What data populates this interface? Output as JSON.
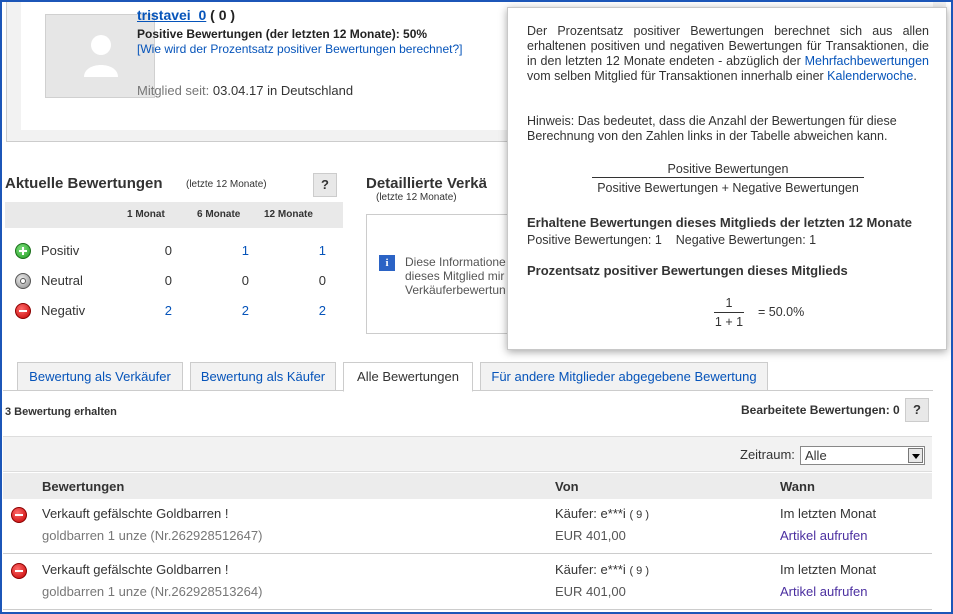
{
  "profile": {
    "username": "tristavei_0",
    "score": "( 0 )",
    "positive_percentage": "Positive Bewertungen (der letzten 12 Monate): 50%",
    "percentage_link": "[Wie wird der Prozentsatz positiver Bewertungen berechnet?]",
    "member_since_label": "Mitglied seit:",
    "member_since_value": "03.04.17 in Deutschland"
  },
  "current_ratings": {
    "title": "Aktuelle Bewertungen",
    "subtitle": "(letzte 12 Monate)",
    "help": "?",
    "columns": [
      "1 Monat",
      "6 Monate",
      "12 Monate"
    ],
    "rows": [
      {
        "label": "Positiv",
        "values": [
          "0",
          "1",
          "1"
        ]
      },
      {
        "label": "Neutral",
        "values": [
          "0",
          "0",
          "0"
        ]
      },
      {
        "label": "Negativ",
        "values": [
          "2",
          "2",
          "2"
        ]
      }
    ]
  },
  "detailed": {
    "title": "Detaillierte Verkä",
    "subtitle": "(letzte 12 Monate)",
    "info_lines": [
      "Diese Informatione",
      "dieses Mitglied mir",
      "Verkäuferbewertun"
    ]
  },
  "tabs": [
    "Bewertung als Verkäufer",
    "Bewertung als Käufer",
    "Alle Bewertungen",
    "Für andere Mitglieder abgegebene Bewertung"
  ],
  "received_text": "3 Bewertung erhalten",
  "edited_text": "Bearbeitete Bewertungen: 0",
  "edited_help": "?",
  "filter": {
    "label": "Zeitraum:",
    "selected": "Alle"
  },
  "list_headers": {
    "ratings": "Bewertungen",
    "from": "Von",
    "when": "Wann"
  },
  "feedback": [
    {
      "title": "Verkauft gefälschte Goldbarren !",
      "item": "goldbarren 1 unze (Nr.262928512647)",
      "buyer": "Käufer: e***i",
      "buyer_score": "( 9 )",
      "price": "EUR 401,00",
      "when": "Im letzten Monat",
      "link": "Artikel aufrufen"
    },
    {
      "title": "Verkauft gefälschte Goldbarren !",
      "item": "goldbarren 1 unze (Nr.262928513264)",
      "buyer": "Käufer: e***i",
      "buyer_score": "( 9 )",
      "price": "EUR 401,00",
      "when": "Im letzten Monat",
      "link": "Artikel aufrufen"
    }
  ],
  "tooltip": {
    "p1_a": "Der Prozentsatz positiver Bewertungen berechnet sich aus allen erhaltenen positiven und negativen Bewertungen für Transaktionen, die in den letzten 12 Monate endeten - abzüglich der ",
    "p1_link1": "Mehrfachbewertungen",
    "p1_b": " vom selben Mitglied für Transaktionen innerhalb einer ",
    "p1_link2": "Kalenderwoche",
    "p1_c": ".",
    "p2": "Hinweis: Das bedeutet, dass die Anzahl der Bewertungen für diese Berechnung von den Zahlen links in der Tabelle abweichen kann.",
    "formula_num": "Positive Bewertungen",
    "formula_den": "Positive Bewertungen + Negative Bewertungen",
    "h1": "Erhaltene Bewertungen dieses Mitglieds der letzten 12 Monate",
    "counts_pos": "Positive Bewertungen: 1",
    "counts_neg": "Negative Bewertungen: 1",
    "h2": "Prozentsatz positiver Bewertungen dieses Mitglieds",
    "result_num": "1",
    "result_den": "1 + 1",
    "result_eq": "=  50.0%"
  }
}
